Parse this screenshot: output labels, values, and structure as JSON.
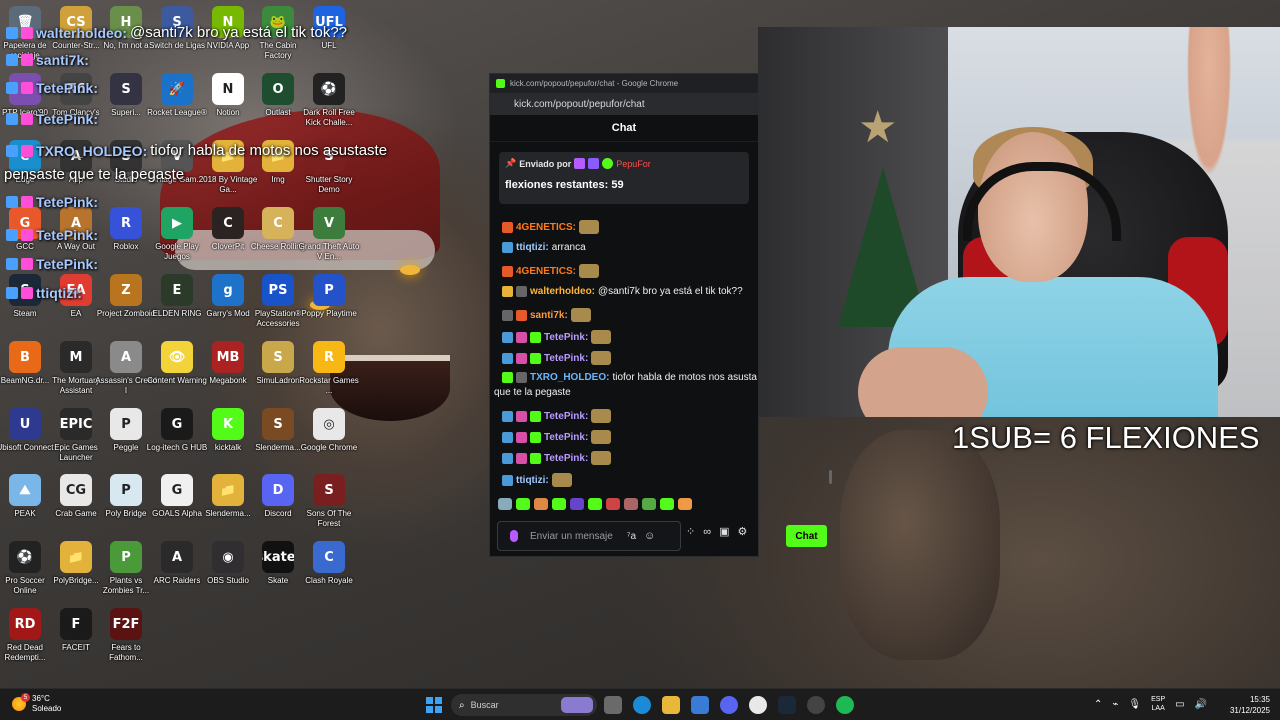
{
  "desktop_icons": [
    {
      "label": "Papelera de reciclaje",
      "color": "#5b6b7a",
      "glyph": "🗑"
    },
    {
      "label": "Counter-Str...",
      "color": "#d0a13a",
      "glyph": "CS"
    },
    {
      "label": "No, I'm not a",
      "color": "#6a8f4a",
      "glyph": "H"
    },
    {
      "label": "Switch de Ligas",
      "color": "#3d5a9e",
      "glyph": "S"
    },
    {
      "label": "NVIDIA App",
      "color": "#76b900",
      "glyph": "N"
    },
    {
      "label": "The Cabin Factory",
      "color": "#3c8a3c",
      "glyph": "🐸"
    },
    {
      "label": "UFL",
      "color": "#1e64e0",
      "glyph": "UFL"
    },
    {
      "label": "PTP Icaro'90",
      "color": "#7b4fb0",
      "glyph": "P"
    },
    {
      "label": "Tom Clancy's",
      "color": "#444",
      "glyph": "R6"
    },
    {
      "label": "Superi...",
      "color": "#334",
      "glyph": "S"
    },
    {
      "label": "Rocket League®",
      "color": "#1a73c9",
      "glyph": "🚀"
    },
    {
      "label": "Notion",
      "color": "#ffffff",
      "glyph": "N"
    },
    {
      "label": "Outlast",
      "color": "#1f4d2f",
      "glyph": "O"
    },
    {
      "label": "Dark Roll Free Kick Challe...",
      "color": "#222",
      "glyph": "⚽"
    },
    {
      "label": "Edge",
      "color": "#1a8fce",
      "glyph": "e"
    },
    {
      "label": "App",
      "color": "#333",
      "glyph": "A"
    },
    {
      "label": "Studio",
      "color": "#333",
      "glyph": "S"
    },
    {
      "label": "vintage Gam...",
      "color": "#555",
      "glyph": "V"
    },
    {
      "label": "2018 By Vintage Ga...",
      "color": "#e2b23a",
      "glyph": "📁"
    },
    {
      "label": "Img",
      "color": "#e2b23a",
      "glyph": "📁"
    },
    {
      "label": "Shutter Story Demo",
      "color": "#7a1f1f",
      "glyph": "S"
    },
    {
      "label": "GCC",
      "color": "#e8582a",
      "glyph": "G"
    },
    {
      "label": "A Way Out",
      "color": "#b8742d",
      "glyph": "A"
    },
    {
      "label": "Roblox",
      "color": "#3552d8",
      "glyph": "R"
    },
    {
      "label": "Google Play Juegos",
      "color": "#20a464",
      "glyph": "▶"
    },
    {
      "label": "CloverPit",
      "color": "#2b2222",
      "glyph": "C"
    },
    {
      "label": "Cheese Rolling",
      "color": "#d6b25a",
      "glyph": "C"
    },
    {
      "label": "Grand Theft Auto V En...",
      "color": "#3c7c3c",
      "glyph": "V"
    },
    {
      "label": "Steam",
      "color": "#1b2838",
      "glyph": "S"
    },
    {
      "label": "EA",
      "color": "#e03c31",
      "glyph": "EA"
    },
    {
      "label": "Project Zomboid",
      "color": "#b8741e",
      "glyph": "Z"
    },
    {
      "label": "ELDEN RING",
      "color": "#2c3a2a",
      "glyph": "E"
    },
    {
      "label": "Garry's Mod",
      "color": "#1f72c9",
      "glyph": "g"
    },
    {
      "label": "PlayStation® Accessories",
      "color": "#1953c9",
      "glyph": "PS"
    },
    {
      "label": "Poppy Playtime",
      "color": "#2453c9",
      "glyph": "P"
    },
    {
      "label": "BeamNG.dr...",
      "color": "#e86a18",
      "glyph": "B"
    },
    {
      "label": "The Mortuary Assistant",
      "color": "#2a2a2a",
      "glyph": "M"
    },
    {
      "label": "Assassin's Creed I",
      "color": "#8a8a8a",
      "glyph": "A"
    },
    {
      "label": "Content Warning",
      "color": "#f2d33a",
      "glyph": "👁"
    },
    {
      "label": "Megabonk",
      "color": "#aa2222",
      "glyph": "MB"
    },
    {
      "label": "SimuLadron",
      "color": "#c8a84a",
      "glyph": "S"
    },
    {
      "label": "Rockstar Games ...",
      "color": "#f7b815",
      "glyph": "R"
    },
    {
      "label": "Ubisoft Connect",
      "color": "#2e3a8f",
      "glyph": "U"
    },
    {
      "label": "Epic Games Launcher",
      "color": "#2a2a2a",
      "glyph": "EPIC"
    },
    {
      "label": "Peggle",
      "color": "#e8e8e8",
      "glyph": "P"
    },
    {
      "label": "Log-itech G HUB",
      "color": "#1a1a1a",
      "glyph": "G"
    },
    {
      "label": "kicktalk",
      "color": "#53fc18",
      "glyph": "K"
    },
    {
      "label": "Slenderma...",
      "color": "#7a4a22",
      "glyph": "S"
    },
    {
      "label": "Google Chrome",
      "color": "#e8e8e8",
      "glyph": "◎"
    },
    {
      "label": "PEAK",
      "color": "#7ab6e8",
      "glyph": "⛰"
    },
    {
      "label": "Crab Game",
      "color": "#e8e8e8",
      "glyph": "CG"
    },
    {
      "label": "Poly Bridge",
      "color": "#d8e8f0",
      "glyph": "P"
    },
    {
      "label": "GOALS Alpha",
      "color": "#f0f0f0",
      "glyph": "G"
    },
    {
      "label": "Slenderma...",
      "color": "#e2b23a",
      "glyph": "📁"
    },
    {
      "label": "Discord",
      "color": "#5865f2",
      "glyph": "D"
    },
    {
      "label": "Sons Of The Forest",
      "color": "#7a1f1f",
      "glyph": "S"
    },
    {
      "label": "Pro Soccer Online",
      "color": "#222",
      "glyph": "⚽"
    },
    {
      "label": "PolyBridge...",
      "color": "#e2b23a",
      "glyph": "📁"
    },
    {
      "label": "Plants vs Zombies Tr...",
      "color": "#4a9a3a",
      "glyph": "P"
    },
    {
      "label": "ARC Raiders",
      "color": "#2a2a2a",
      "glyph": "A"
    },
    {
      "label": "OBS Studio",
      "color": "#302e31",
      "glyph": "◉"
    },
    {
      "label": "Skate",
      "color": "#111",
      "glyph": "skate."
    },
    {
      "label": "Clash Royale",
      "color": "#3a6ad0",
      "glyph": "C"
    },
    {
      "label": "Red Dead Redempti...",
      "color": "#a01818",
      "glyph": "RD"
    },
    {
      "label": "FACEIT",
      "color": "#1a1a1a",
      "glyph": "F"
    },
    {
      "label": "Fears to Fathom...",
      "color": "#5a1212",
      "glyph": "F2F"
    }
  ],
  "overlay_chat": [
    {
      "user": "walterholdeo:",
      "text": "@santi7k bro ya está el tik tok??"
    },
    {
      "user": "santi7k:",
      "text": ""
    },
    {
      "user": "TetePink:",
      "text": ""
    },
    {
      "user": "TetePink:",
      "text": ""
    },
    {
      "user": "TXRO_HOLDEO:",
      "text": "tiofor habla de motos nos asustaste"
    },
    {
      "user": "",
      "text": "pensaste que te la pegaste"
    },
    {
      "user": "TetePink:",
      "text": ""
    },
    {
      "user": "TetePink:",
      "text": ""
    },
    {
      "user": "TetePink:",
      "text": ""
    },
    {
      "user": "ttiqtizi:",
      "text": ""
    }
  ],
  "browser": {
    "window_title": "kick.com/popout/pepufor/chat - Google Chrome",
    "url": "kick.com/popout/pepufor/chat",
    "header": "Chat",
    "pinned": {
      "label": "Enviado por",
      "user": "PepuFor",
      "text": "flexiones restantes: 59"
    },
    "messages": [
      {
        "user": "4GENETICS:",
        "color": "#ff7a1a",
        "text": ""
      },
      {
        "user": "ttiqtizi:",
        "color": "#9ec9ff",
        "text": "arranca"
      },
      {
        "user": "4GENETICS:",
        "color": "#ff7a1a",
        "text": ""
      },
      {
        "user": "walterholdeo:",
        "color": "#ffb63a",
        "text": "@santi7k bro ya está el tik tok??"
      },
      {
        "user": "santi7k:",
        "color": "#ff9a3a",
        "text": ""
      },
      {
        "user": "TetePink:",
        "color": "#b99cff",
        "text": ""
      },
      {
        "user": "TetePink:",
        "color": "#b99cff",
        "text": ""
      },
      {
        "user": "TXRO_HOLDEO:",
        "color": "#6ab7ff",
        "text": "tiofor habla de motos nos asusta"
      },
      {
        "user": "",
        "color": "#fff",
        "text": "que te la pegaste"
      },
      {
        "user": "TetePink:",
        "color": "#b99cff",
        "text": ""
      },
      {
        "user": "TetePink:",
        "color": "#b99cff",
        "text": ""
      },
      {
        "user": "TetePink:",
        "color": "#b99cff",
        "text": ""
      },
      {
        "user": "ttiqtizi:",
        "color": "#9ec9ff",
        "text": ""
      }
    ],
    "input_placeholder": "Enviar un mensaje",
    "chat_button": "Chat",
    "infinity": "∞"
  },
  "stream_overlay_text": "1SUB= 6 FLEXIONES",
  "taskbar": {
    "temperature": "36°C",
    "condition": "Soleado",
    "weather_badge": "5",
    "search_placeholder": "Buscar",
    "lang_top": "ESP",
    "lang_bottom": "LAA",
    "time": "15:35",
    "date": "31/12/2025"
  }
}
